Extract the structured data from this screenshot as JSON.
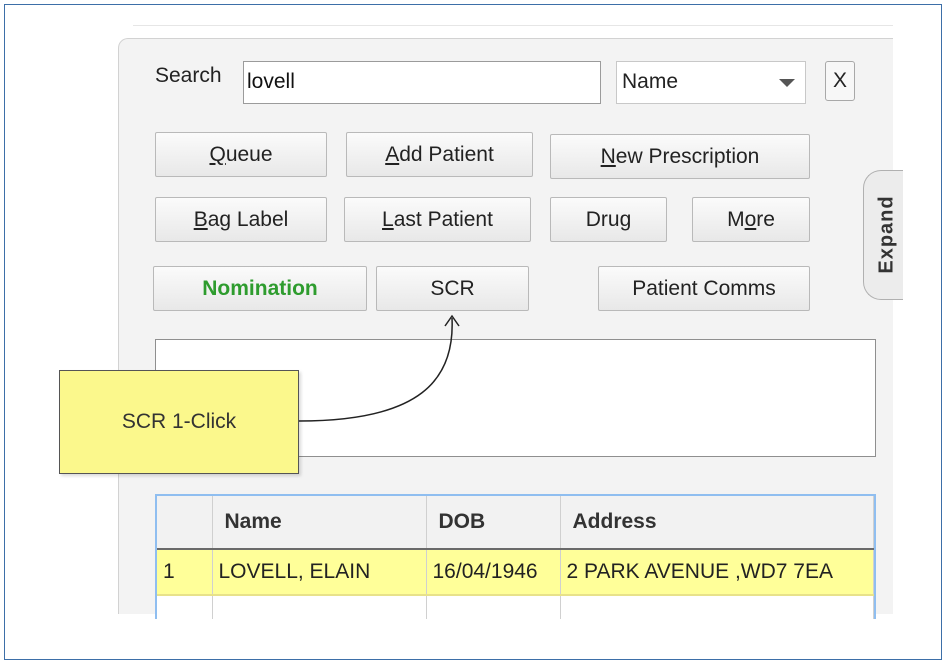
{
  "search": {
    "label": "Search",
    "value": "lovell",
    "type_value": "Name",
    "clear_label": "X"
  },
  "buttons": {
    "queue": {
      "pre": "",
      "key": "Q",
      "post": "ueue"
    },
    "add_patient": {
      "pre": "",
      "key": "A",
      "post": "dd Patient"
    },
    "new_prescription": {
      "pre": "",
      "key": "N",
      "post": "ew Prescription"
    },
    "bag_label": {
      "pre": "",
      "key": "B",
      "post": "ag Label"
    },
    "last_patient": {
      "pre": "",
      "key": "L",
      "post": "ast Patient"
    },
    "drug": "Drug",
    "more": {
      "pre": "M",
      "key": "o",
      "post": "re"
    },
    "nomination": "Nomination",
    "scr": "SCR",
    "patient_comms": "Patient Comms"
  },
  "expand_tab": "Expand",
  "callout": "SCR 1-Click",
  "results": {
    "columns": [
      "",
      "Name",
      "DOB",
      "Address"
    ],
    "rows": [
      {
        "index": "1",
        "name": "LOVELL, ELAIN",
        "dob": "16/04/1946",
        "address": "2 PARK AVENUE ,WD7 7EA"
      }
    ]
  },
  "colors": {
    "nomination_text": "#2e9c2e",
    "selected_row": "#ffff99",
    "callout_fill": "#fbf88c",
    "frame_border": "#3d6fa8"
  }
}
